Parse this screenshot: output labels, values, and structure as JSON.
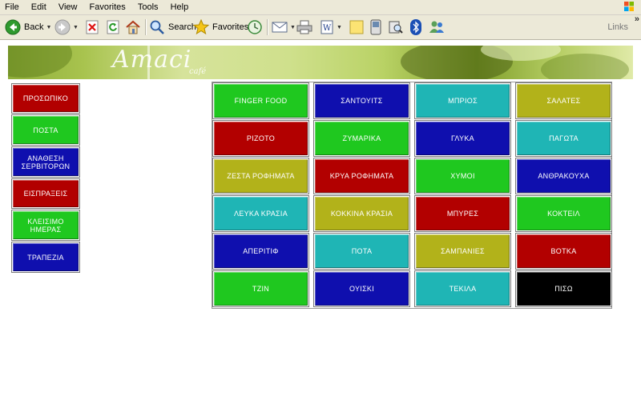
{
  "menu": {
    "items": [
      "File",
      "Edit",
      "View",
      "Favorites",
      "Tools",
      "Help"
    ]
  },
  "toolbar": {
    "back_label": "Back",
    "search_label": "Search",
    "favorites_label": "Favorites",
    "links_label": "Links",
    "overflow": "»"
  },
  "banner": {
    "brand": "Amaci",
    "sub": "café"
  },
  "sidebar": {
    "items": [
      {
        "label": "ΠΡΟΣΩΠΙΚΟ",
        "color": "#b20000"
      },
      {
        "label": "ΠΟΣΤΑ",
        "color": "#1fc81f"
      },
      {
        "label": "ΑΝΑΘΕΣΗ ΣΕΡΒΙΤΟΡΩΝ",
        "color": "#0f0fae"
      },
      {
        "label": "ΕΙΣΠΡΑΞΕΙΣ",
        "color": "#b20000"
      },
      {
        "label": "ΚΛΕΙΣΙΜΟ ΗΜΕΡΑΣ",
        "color": "#1fc81f"
      },
      {
        "label": "ΤΡΑΠΕΖΙΑ",
        "color": "#0f0fae"
      }
    ]
  },
  "grid": {
    "cells": [
      {
        "label": "FINGER FOOD",
        "color": "#1fc81f"
      },
      {
        "label": "ΣΑΝΤΟΥΙΤΣ",
        "color": "#0f0fae"
      },
      {
        "label": "ΜΠΡΙΟΣ",
        "color": "#1fb5b5"
      },
      {
        "label": "ΣΑΛΑΤΕΣ",
        "color": "#b2b21a"
      },
      {
        "label": "ΡΙΖΟΤΟ",
        "color": "#b20000"
      },
      {
        "label": "ΖΥΜΑΡΙΚΑ",
        "color": "#1fc81f"
      },
      {
        "label": "ΓΛΥΚΑ",
        "color": "#0f0fae"
      },
      {
        "label": "ΠΑΓΩΤΑ",
        "color": "#1fb5b5"
      },
      {
        "label": "ΖΕΣΤΑ ΡΟΦΗΜΑΤΑ",
        "color": "#b2b21a"
      },
      {
        "label": "ΚΡΥΑ ΡΟΦΗΜΑΤΑ",
        "color": "#b20000"
      },
      {
        "label": "ΧΥΜΟΙ",
        "color": "#1fc81f"
      },
      {
        "label": "ΑΝΘΡΑΚΟΥΧΑ",
        "color": "#0f0fae"
      },
      {
        "label": "ΛΕΥΚΑ ΚΡΑΣΙΑ",
        "color": "#1fb5b5"
      },
      {
        "label": "ΚΟΚΚΙΝΑ ΚΡΑΣΙΑ",
        "color": "#b2b21a"
      },
      {
        "label": "ΜΠΥΡΕΣ",
        "color": "#b20000"
      },
      {
        "label": "ΚΟΚΤΕΙΛ",
        "color": "#1fc81f"
      },
      {
        "label": "ΑΠΕΡΙΤΙΦ",
        "color": "#0f0fae"
      },
      {
        "label": "ΠΟΤΑ",
        "color": "#1fb5b5"
      },
      {
        "label": "ΣΑΜΠΑΝΙΕΣ",
        "color": "#b2b21a"
      },
      {
        "label": "ΒΟΤΚΑ",
        "color": "#b20000"
      },
      {
        "label": "ΤΖΙΝ",
        "color": "#1fc81f"
      },
      {
        "label": "ΟΥΙΣΚΙ",
        "color": "#0f0fae"
      },
      {
        "label": "ΤΕΚΙΛΑ",
        "color": "#1fb5b5"
      },
      {
        "label": "ΠΙΣΩ",
        "color": "#000000"
      }
    ]
  }
}
